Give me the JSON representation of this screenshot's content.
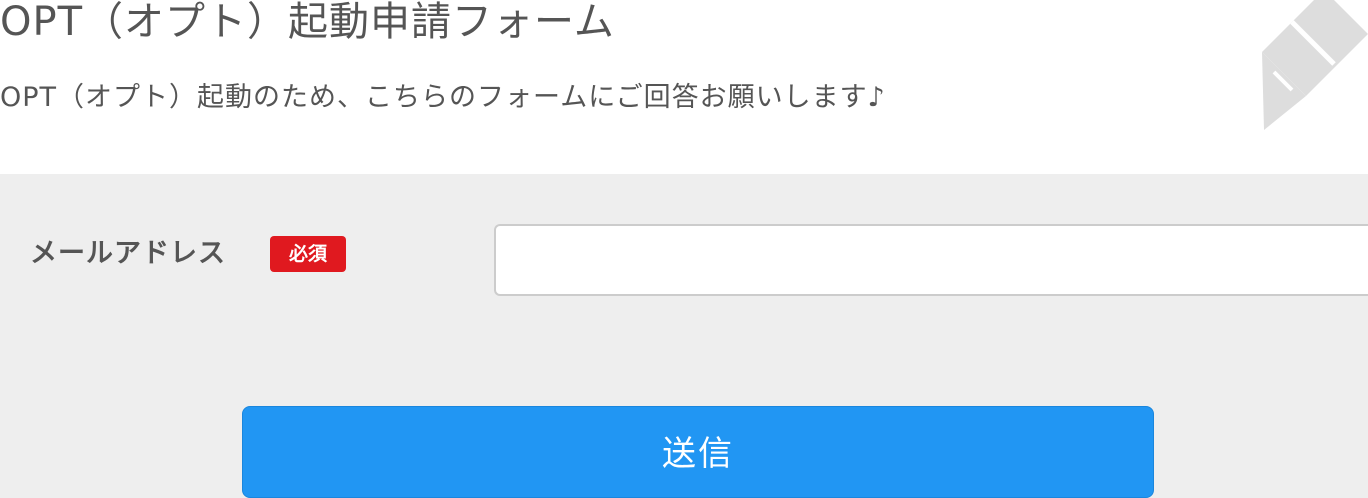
{
  "header": {
    "title": "OPT（オプト）起動申請フォーム",
    "subtitle": "OPT（オプト）起動のため、こちらのフォームにご回答お願いします♪",
    "decoration_icon": "pencil-icon",
    "icon_color": "#dddddd"
  },
  "form": {
    "email_label": "メールアドレス",
    "required_label": "必須",
    "email_value": "",
    "email_placeholder": "",
    "submit_label": "送信"
  },
  "colors": {
    "form_background": "#eeeeee",
    "required_badge": "#e0191f",
    "submit_button": "#2196f3",
    "text": "#555555"
  }
}
